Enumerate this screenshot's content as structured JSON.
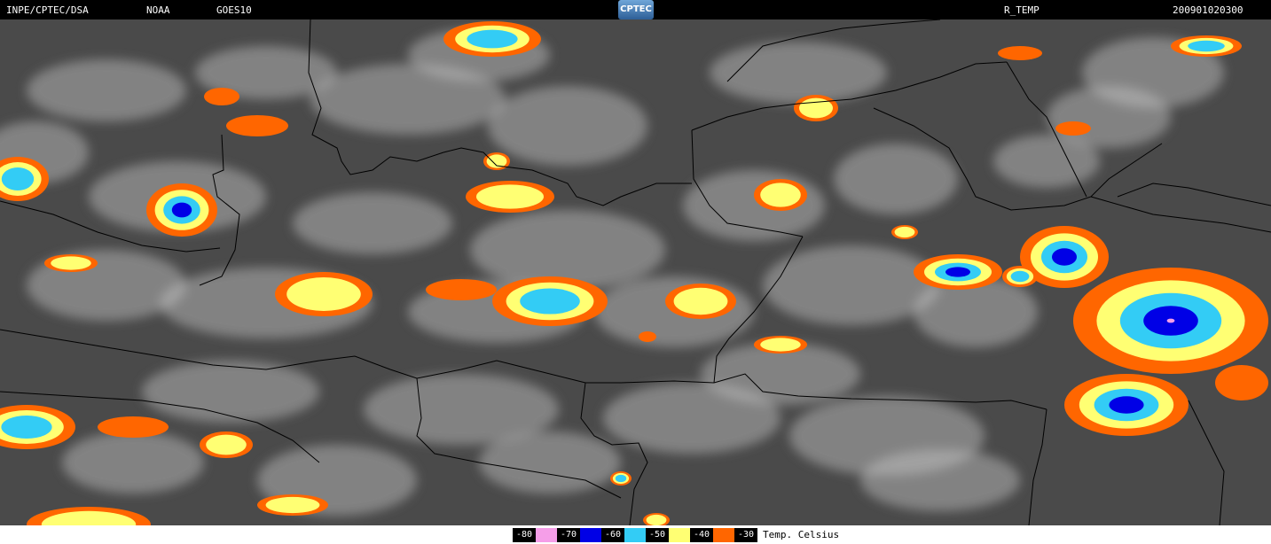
{
  "header": {
    "source": "INPE/CPTEC/DSA",
    "agency": "NOAA",
    "satellite": "GOES10",
    "logo_text": "CPTEC",
    "product": "R_TEMP",
    "timestamp": "200901020300"
  },
  "map": {
    "background_color": "#4a4a4a",
    "border_color": "#000000",
    "cloud_color": "#c8c8c8"
  },
  "legend": {
    "title": "Temp. Celsius",
    "items": [
      {
        "label": "-80",
        "color": "#f59ee8"
      },
      {
        "label": "-70",
        "color": "#0000e6"
      },
      {
        "label": "-60",
        "color": "#33ccf5"
      },
      {
        "label": "-50",
        "color": "#ffff73"
      },
      {
        "label": "-40",
        "color": "#ff6600"
      },
      {
        "label": "-30",
        "color": ""
      }
    ]
  }
}
